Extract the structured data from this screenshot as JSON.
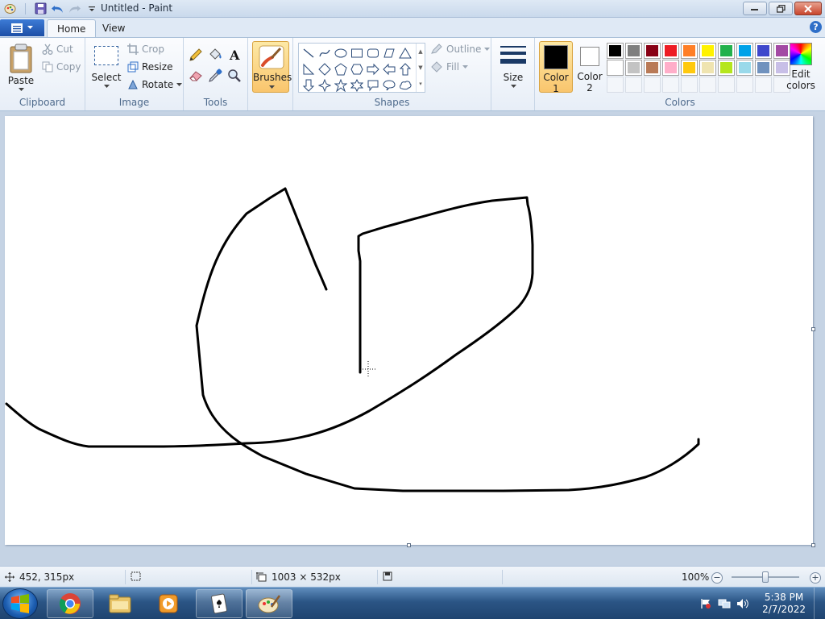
{
  "window": {
    "title": "Untitled - Paint"
  },
  "tabs": [
    {
      "label": "Home",
      "active": true
    },
    {
      "label": "View",
      "active": false
    }
  ],
  "ribbon": {
    "clipboard": {
      "group_label": "Clipboard",
      "paste": "Paste",
      "cut": "Cut",
      "copy": "Copy"
    },
    "image": {
      "group_label": "Image",
      "select": "Select",
      "crop": "Crop",
      "resize": "Resize",
      "rotate": "Rotate"
    },
    "tools": {
      "group_label": "Tools",
      "items": [
        "pencil-icon",
        "fill-bucket-icon",
        "text-icon",
        "eraser-icon",
        "color-picker-icon",
        "magnifier-icon"
      ]
    },
    "brushes": {
      "label": "Brushes"
    },
    "shapes": {
      "group_label": "Shapes",
      "outline": "Outline",
      "fill": "Fill"
    },
    "size": {
      "label": "Size"
    },
    "colors": {
      "group_label": "Colors",
      "color1": {
        "label_line1": "Color",
        "label_line2": "1",
        "value": "#000000"
      },
      "color2": {
        "label_line1": "Color",
        "label_line2": "2",
        "value": "#ffffff"
      },
      "edit_colors_line1": "Edit",
      "edit_colors_line2": "colors",
      "palette_row1": [
        "#000000",
        "#7f7f7f",
        "#880015",
        "#ed1c24",
        "#ff7f27",
        "#fff200",
        "#22b14c",
        "#00a2e8",
        "#3f48cc",
        "#a349a4"
      ],
      "palette_row2": [
        "#ffffff",
        "#c3c3c3",
        "#b97a57",
        "#ffaec9",
        "#ffc90e",
        "#efe4b0",
        "#b5e61d",
        "#99d9ea",
        "#7092be",
        "#c8bfe7"
      ]
    }
  },
  "canvas": {
    "background": "#ffffff",
    "stroke": "#000000"
  },
  "status": {
    "cursor_pos": "452, 315px",
    "canvas_size": "1003 × 532px",
    "zoom": "100%"
  },
  "taskbar": {
    "apps": [
      "chrome-icon",
      "explorer-icon",
      "media-player-icon",
      "solitaire-icon",
      "paint-icon"
    ],
    "time": "5:38 PM",
    "date": "2/7/2022"
  }
}
